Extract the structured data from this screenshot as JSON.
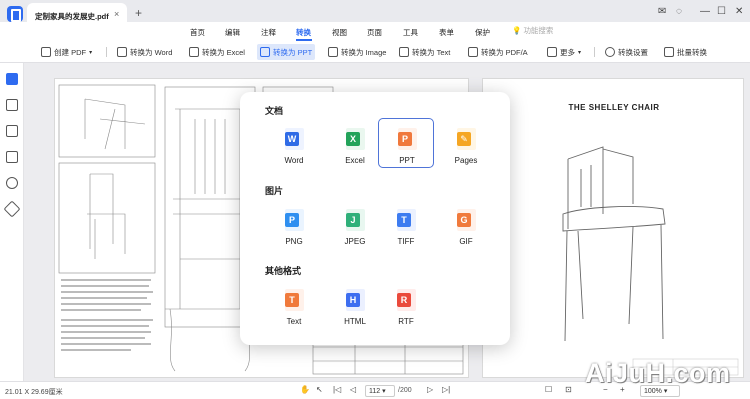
{
  "titlebar": {
    "document_tab": "定制家具的发展史.pdf",
    "close_tab": "×",
    "new_tab": "+"
  },
  "menu": {
    "items": [
      "首页",
      "编辑",
      "注释",
      "转换",
      "视图",
      "页面",
      "工具",
      "表单",
      "保护"
    ],
    "active_index": 3,
    "feature_search": "功能搜索"
  },
  "toolbar": {
    "buttons": [
      "创建 PDF",
      "转换为 Word",
      "转换为 Excel",
      "转换为 PPT",
      "转换为 Image",
      "转换为 Text",
      "转换为 PDF/A",
      "更多",
      "转换设置",
      "批量转换"
    ],
    "active": "转换为 PPT"
  },
  "page": {
    "right_title": "THE SHELLEY CHAIR"
  },
  "panel": {
    "sections": [
      {
        "title": "文档",
        "formats": [
          {
            "label": "Word",
            "letter": "W",
            "color": "#2f6be6"
          },
          {
            "label": "Excel",
            "letter": "X",
            "color": "#23a35a"
          },
          {
            "label": "PPT",
            "letter": "P",
            "color": "#f0783c",
            "selected": true
          },
          {
            "label": "Pages",
            "letter": "P",
            "color": "#f5a623"
          }
        ]
      },
      {
        "title": "图片",
        "formats": [
          {
            "label": "PNG",
            "letter": "P",
            "color": "#2f8ff0"
          },
          {
            "label": "JPEG",
            "letter": "J",
            "color": "#2fb07a"
          },
          {
            "label": "TIFF",
            "letter": "T",
            "color": "#3d7cf0"
          },
          {
            "label": "GIF",
            "letter": "G",
            "color": "#f07a3c"
          }
        ]
      },
      {
        "title": "其他格式",
        "formats": [
          {
            "label": "Text",
            "letter": "T",
            "color": "#f07a3c"
          },
          {
            "label": "HTML",
            "letter": "H",
            "color": "#3d6ef0"
          },
          {
            "label": "RTF",
            "letter": "R",
            "color": "#ea4a3c"
          }
        ]
      }
    ]
  },
  "statusbar": {
    "dimensions": "21.01 X 29.69厘米",
    "current_page": "112",
    "total_pages": "/200",
    "zoom": "100%"
  },
  "watermark": "AiJuH.com"
}
